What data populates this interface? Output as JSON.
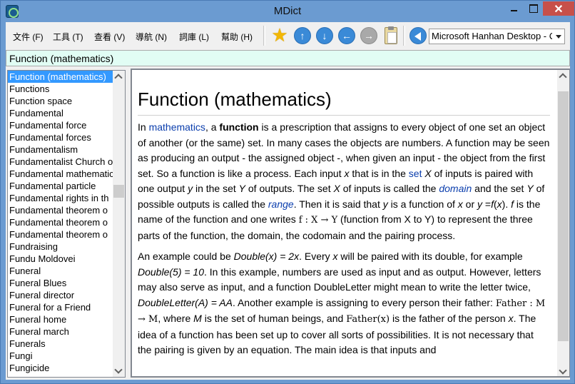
{
  "window": {
    "title": "MDict",
    "close_glyph": "✕"
  },
  "menu": [
    {
      "label": "文件 (F)"
    },
    {
      "label": "工具 (T)"
    },
    {
      "label": "查看 (V)"
    },
    {
      "label": "導航 (N)"
    },
    {
      "label": "詞庫 (L)"
    },
    {
      "label": "幫助 (H)"
    }
  ],
  "toolbar": {
    "icons": [
      "favorite-star-icon",
      "up-arrow-icon",
      "down-arrow-icon",
      "back-arrow-icon",
      "forward-arrow-icon",
      "clipboard-icon",
      "speaker-icon"
    ],
    "glyphs": {
      "star": "★",
      "up": "↑",
      "down": "↓",
      "back": "←",
      "forward": "→"
    },
    "voice_selected": "Microsoft Hanhan Desktop - C"
  },
  "search": {
    "value": "Function (mathematics)"
  },
  "wordlist": {
    "selected_index": 0,
    "items": [
      "Function (mathematics)",
      "Functions",
      "Function space",
      "Fundamental",
      "Fundamental force",
      "Fundamental forces",
      "Fundamentalism",
      "Fundamentalist Church of",
      "Fundamental mathematics",
      "Fundamental particle",
      "Fundamental rights in th",
      "Fundamental theorem o",
      "Fundamental theorem o",
      "Fundamental theorem o",
      "Fundraising",
      "Fundu Moldovei",
      "Funeral",
      "Funeral Blues",
      "Funeral director",
      "Funeral for a Friend",
      "Funeral home",
      "Funeral march",
      "Funerals",
      "Fungi",
      "Fungicide"
    ]
  },
  "article": {
    "title": "Function (mathematics)",
    "p1": {
      "t1": "In ",
      "link_mathematics": "mathematics",
      "t2": ", a ",
      "bold_function": "function",
      "t3": " is a prescription that assigns to every object of one set an object of another (or the same) set. In many cases the objects are numbers. A function may be seen as producing an output - the assigned object -, when given an input - the object from the first set. So a function is like a process. Each input ",
      "x1": "x",
      "t4": " that is in the ",
      "link_set": "set",
      "t5": " ",
      "X1": "X",
      "t6": " of inputs is paired with one output ",
      "y1": "y",
      "t7": " in the set ",
      "Y1": "Y",
      "t8": " of outputs. The set ",
      "X2": "X",
      "t9": " of inputs is called the ",
      "link_domain": "domain",
      "t10": " and the set ",
      "Y2": "Y",
      "t11": " of possible outputs is called the ",
      "link_range": "range",
      "t12": ". Then it is said that ",
      "y2": "y",
      "t13": " is a function of ",
      "x2": "x",
      "t14": " or ",
      "y3": "y",
      "t15": " =",
      "fx": "f",
      "t16": "(",
      "x3": "x",
      "t17": "). ",
      "f2": "f",
      "t18": " is the name of the function and one writes ",
      "math1": "f : X → Y",
      "t19": " (function from X to Y) to represent the three parts of the function, the domain, the codomain and the pairing process."
    },
    "p2": {
      "t1": "An example could be ",
      "ex1": "Double(x) = 2x",
      "t2": ". Every ",
      "x1": "x",
      "t3": " will be paired with its double, for example ",
      "ex2": "Double(5) = 10",
      "t4": ". In this example, numbers are used as input and as output. However, letters may also serve as input, and a function DoubleLetter might mean to write the letter twice, ",
      "ex3": "DoubleLetter(A) = AA",
      "t5": ". Another example is assigning to every person their father: ",
      "math1": "Father : M → M",
      "t6": ", where ",
      "M": "M",
      "t7": " is the set of human beings, and ",
      "math2": "Father(x)",
      "t8": " is the father of the person ",
      "x2": "x",
      "t9": ". The idea of a function has been set up to cover all sorts of possibilities. It is not necessary that the pairing is given by an equation. The main idea is that inputs and"
    }
  },
  "scroll": {
    "wordlist_fraction": 0.38,
    "article_fraction": 0.0
  }
}
